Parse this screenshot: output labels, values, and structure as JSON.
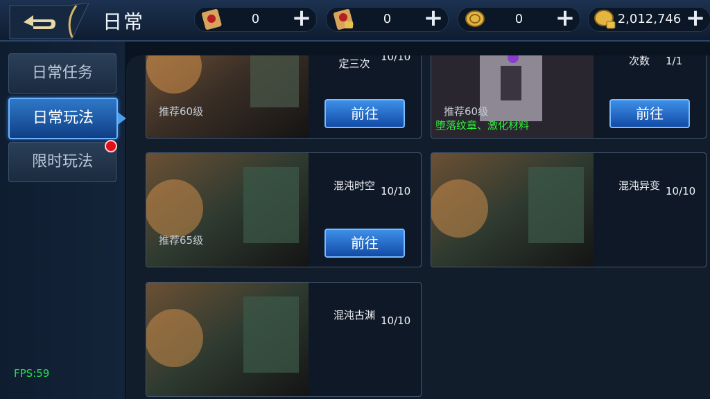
{
  "header": {
    "title": "日常",
    "resources": [
      {
        "icon": "scroll-icon",
        "value": "0"
      },
      {
        "icon": "locked-scroll-icon",
        "value": "0"
      },
      {
        "icon": "coin-icon",
        "value": "0"
      },
      {
        "icon": "locked-coin-icon",
        "value": "2,012,746"
      }
    ],
    "plus": "+"
  },
  "sidebar": {
    "items": [
      {
        "label": "日常任务"
      },
      {
        "label": "日常玩法"
      },
      {
        "label": "限时玩法"
      }
    ]
  },
  "cards": [
    {
      "name": "定三次",
      "count": "10/10",
      "rec": "推荐60级",
      "button": "前往"
    },
    {
      "name": "次数",
      "count": "1/1",
      "rec": "推荐60级",
      "materials": "堕落纹章、激化材料",
      "button": "前往"
    },
    {
      "name": "混沌时空",
      "count": "10/10",
      "rec": "推荐65级",
      "button": "前往"
    },
    {
      "name": "混沌异变",
      "count": "10/10"
    },
    {
      "name": "混沌古渊",
      "count": "10/10"
    }
  ],
  "fps": "FPS:59",
  "colors": {
    "accent": "#2f78c8",
    "badge": "#e0101a",
    "fps": "#22e24a",
    "materials": "#2cf03a"
  }
}
